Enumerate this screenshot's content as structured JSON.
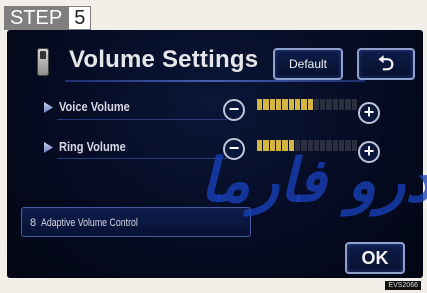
{
  "step": {
    "label": "STEP",
    "number": "5"
  },
  "screen": {
    "title": "Volume Settings",
    "default_label": "Default",
    "back_glyph": "⮌",
    "rows": [
      {
        "label": "Voice Volume",
        "minus": "−",
        "plus": "+",
        "level_fraction": 0.56,
        "segments": 16
      },
      {
        "label": "Ring Volume",
        "minus": "−",
        "plus": "+",
        "level_fraction": 0.38,
        "segments": 16
      }
    ],
    "adaptive_prefix": "8",
    "adaptive_label": "Adaptive Volume Control",
    "ok_label": "OK"
  },
  "watermark": "ﺩﺭﻭ ﻓﺎﺭﻣﺎ",
  "corner_tag": "EVS2066",
  "colors": {
    "bar_on": "#d4b640",
    "bar_off": "#2a2e3e",
    "screen_bg": "#050b22",
    "watermark": "#1840ba"
  }
}
